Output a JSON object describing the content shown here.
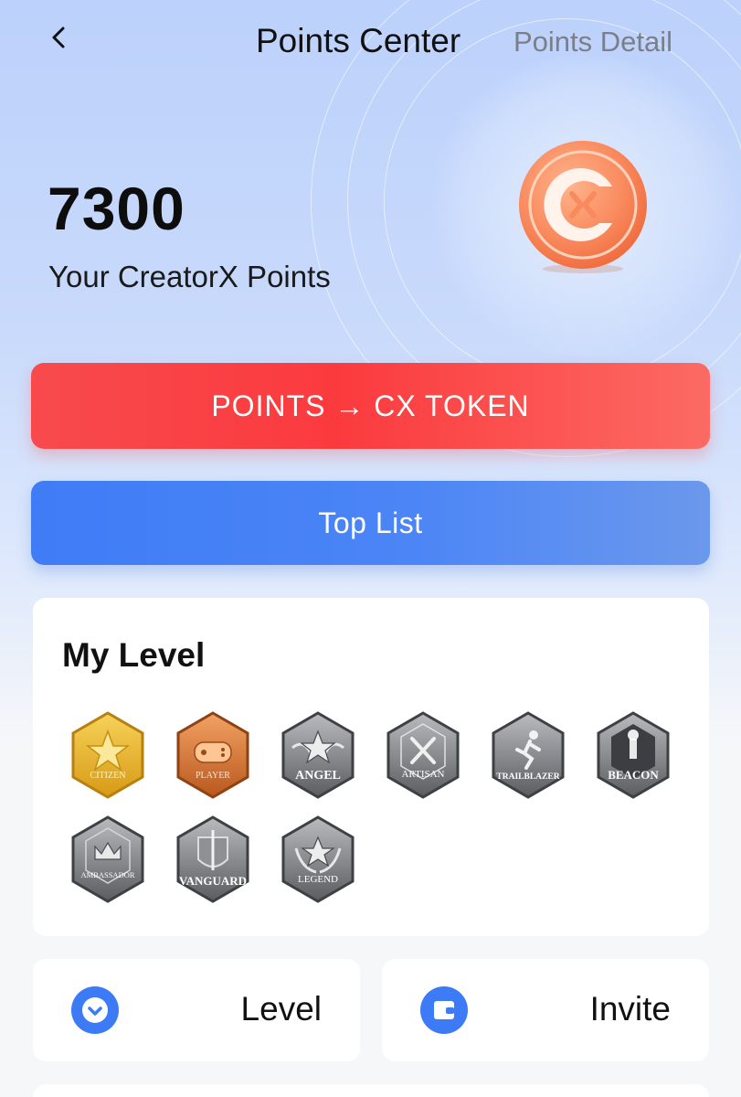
{
  "header": {
    "title": "Points Center",
    "detail_link": "Points Detail"
  },
  "points": {
    "value": "7300",
    "label": "Your CreatorX Points"
  },
  "buttons": {
    "token": "POINTS → CX TOKEN",
    "top_list": "Top List"
  },
  "level_section": {
    "title": "My Level",
    "badges": [
      {
        "label": "CITIZEN",
        "icon": "star-icon",
        "tier": "gold",
        "unlocked": true
      },
      {
        "label": "PLAYER",
        "icon": "gamepad-icon",
        "tier": "bronze",
        "unlocked": true
      },
      {
        "label": "ANGEL",
        "icon": "winged-star-icon",
        "tier": "silver",
        "unlocked": false
      },
      {
        "label": "ARTISAN",
        "icon": "tools-icon",
        "tier": "silver",
        "unlocked": false
      },
      {
        "label": "TRAILBLAZER",
        "icon": "runner-icon",
        "tier": "silver",
        "unlocked": false
      },
      {
        "label": "BEACON",
        "icon": "lighthouse-icon",
        "tier": "silver",
        "unlocked": false
      },
      {
        "label": "AMBASSADOR",
        "icon": "crown-icon",
        "tier": "silver",
        "unlocked": false
      },
      {
        "label": "VANGUARD",
        "icon": "sword-shield-icon",
        "tier": "silver",
        "unlocked": false
      },
      {
        "label": "LEGEND",
        "icon": "laurel-star-icon",
        "tier": "silver",
        "unlocked": false
      }
    ]
  },
  "tiles": {
    "level": "Level",
    "invite": "Invite"
  },
  "colors": {
    "accent_red": "#f84a4d",
    "accent_blue": "#3f7cf6",
    "coin_orange": "#f98a5e"
  }
}
